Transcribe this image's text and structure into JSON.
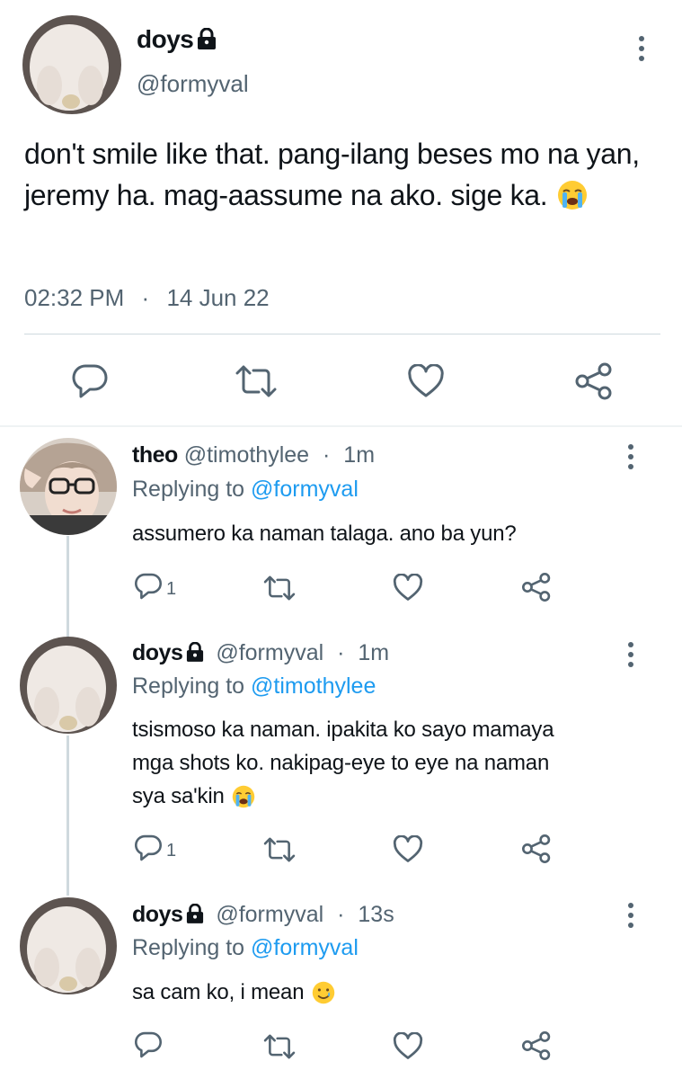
{
  "main_tweet": {
    "display_name": "doys",
    "handle": "@formyval",
    "text": "don't smile like that. pang-ilang beses mo na yan, jeremy ha. mag-aassume na ako. sige ka.",
    "time": "02:32 PM",
    "separator": "·",
    "date": "14 Jun 22"
  },
  "replies": [
    {
      "display_name": "theo",
      "handle": "@timothylee",
      "separator": "·",
      "age": "1m",
      "replying_label": "Replying to",
      "replying_to": "@formyval",
      "text": "assumero ka naman talaga. ano ba yun?",
      "reply_count": "1"
    },
    {
      "display_name": "doys",
      "handle": "@formyval",
      "separator": "·",
      "age": "1m",
      "replying_label": "Replying to",
      "replying_to": "@timothylee",
      "text_line1": "tsismoso ka naman. ipakita ko sayo mamaya",
      "text_line2": "mga shots ko. nakipag-eye to eye na naman",
      "text_line3": "sya sa'kin",
      "reply_count": "1"
    },
    {
      "display_name": "doys",
      "handle": "@formyval",
      "separator": "·",
      "age": "13s",
      "replying_label": "Replying to",
      "replying_to": "@formyval",
      "text": "sa cam ko, i mean",
      "reply_count": ""
    }
  ],
  "icons": {
    "reply": "reply-icon",
    "retweet": "retweet-icon",
    "like": "like-icon",
    "share": "share-icon",
    "more": "more-icon",
    "lock": "lock-icon",
    "crying_emoji": "loudly-crying-face-emoji",
    "smile_tear_emoji": "smiling-face-with-tear-emoji"
  },
  "colors": {
    "text": "#0f1419",
    "muted": "#536471",
    "link": "#1d9bf0",
    "divider": "#cfd9de",
    "thread_line": "#cfd9de"
  }
}
